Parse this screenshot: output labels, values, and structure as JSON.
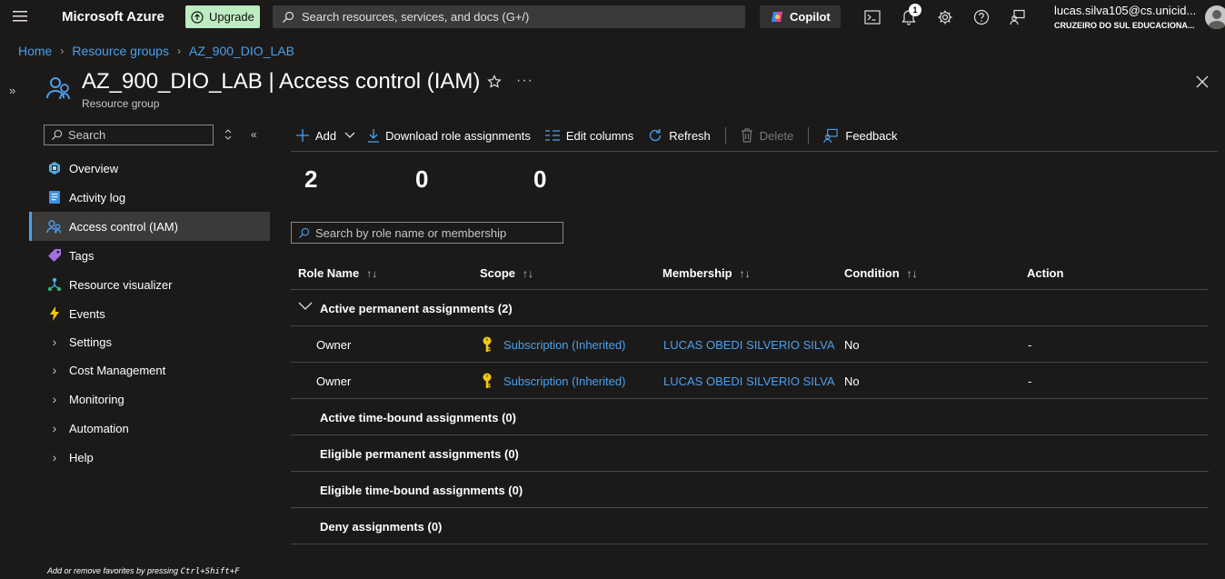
{
  "topbar": {
    "brand": "Microsoft Azure",
    "upgrade_label": "Upgrade",
    "search_placeholder": "Search resources, services, and docs (G+/)",
    "copilot_label": "Copilot",
    "notification_count": "1",
    "user_email": "lucas.silva105@cs.unicid...",
    "user_org": "CRUZEIRO DO SUL EDUCACIONA..."
  },
  "breadcrumb": [
    "Home",
    "Resource groups",
    "AZ_900_DIO_LAB"
  ],
  "header": {
    "title": "AZ_900_DIO_LAB | Access control (IAM)",
    "subtitle": "Resource group",
    "more": "···"
  },
  "sidebar": {
    "search_placeholder": "Search",
    "items": [
      {
        "label": "Overview",
        "icon": "overview-icon"
      },
      {
        "label": "Activity log",
        "icon": "activity-log-icon"
      },
      {
        "label": "Access control (IAM)",
        "icon": "iam-icon",
        "active": true
      },
      {
        "label": "Tags",
        "icon": "tag-icon"
      },
      {
        "label": "Resource visualizer",
        "icon": "visualizer-icon"
      },
      {
        "label": "Events",
        "icon": "lightning-icon"
      },
      {
        "label": "Settings",
        "icon": "chevron-right-icon"
      },
      {
        "label": "Cost Management",
        "icon": "chevron-right-icon"
      },
      {
        "label": "Monitoring",
        "icon": "chevron-right-icon"
      },
      {
        "label": "Automation",
        "icon": "chevron-right-icon"
      },
      {
        "label": "Help",
        "icon": "chevron-right-icon"
      }
    ],
    "fav_hint_prefix": "Add or remove favorites by pressing ",
    "fav_hint_keys": "Ctrl+Shift+F"
  },
  "toolbar": {
    "add": "Add",
    "download": "Download role assignments",
    "edit_columns": "Edit columns",
    "refresh": "Refresh",
    "delete": "Delete",
    "feedback": "Feedback"
  },
  "counters": [
    "2",
    "0",
    "0"
  ],
  "table": {
    "search_placeholder": "Search by role name or membership",
    "columns": [
      "Role Name",
      "Scope",
      "Membership",
      "Condition",
      "Action"
    ],
    "groups": [
      {
        "label": "Active permanent assignments (2)"
      },
      {
        "label": "Active time-bound assignments (0)"
      },
      {
        "label": "Eligible permanent assignments (0)"
      },
      {
        "label": "Eligible time-bound assignments (0)"
      },
      {
        "label": "Deny assignments (0)"
      }
    ],
    "rows": [
      {
        "role": "Owner",
        "scope": "Subscription (Inherited)",
        "membership": "LUCAS OBEDI SILVERIO SILVA",
        "condition": "No",
        "action": "-"
      },
      {
        "role": "Owner",
        "scope": "Subscription (Inherited)",
        "membership": "LUCAS OBEDI SILVERIO SILVA",
        "condition": "No",
        "action": "-"
      }
    ]
  },
  "colors": {
    "accent": "#4aa0f0",
    "background": "#1b1a19",
    "upgrade_bg": "#bdebc2",
    "key_icon": "#f2c811"
  }
}
